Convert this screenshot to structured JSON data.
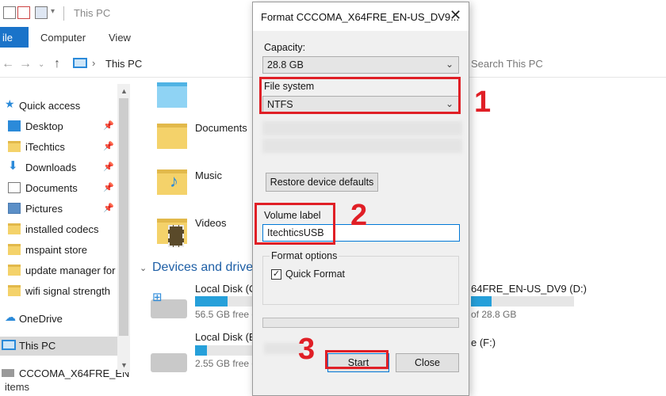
{
  "explorer": {
    "title": "This PC",
    "ribbon_tabs": [
      "ile",
      "Computer",
      "View"
    ],
    "address_text": "This PC",
    "search_placeholder": "Search This PC",
    "nav_items": [
      {
        "label": "Quick access",
        "icon": "star-icon",
        "pinned": false
      },
      {
        "label": "Desktop",
        "icon": "desktop-icon",
        "pinned": true
      },
      {
        "label": "iTechtics",
        "icon": "folder-icon",
        "pinned": true
      },
      {
        "label": "Downloads",
        "icon": "download-icon",
        "pinned": true
      },
      {
        "label": "Documents",
        "icon": "documents-icon",
        "pinned": true
      },
      {
        "label": "Pictures",
        "icon": "pictures-icon",
        "pinned": true
      },
      {
        "label": "installed codecs",
        "icon": "folder-icon",
        "pinned": false
      },
      {
        "label": "mspaint store",
        "icon": "folder-icon",
        "pinned": false
      },
      {
        "label": "update manager for",
        "icon": "folder-icon",
        "pinned": false
      },
      {
        "label": "wifi signal strength",
        "icon": "folder-icon",
        "pinned": false
      },
      {
        "label": "OneDrive",
        "icon": "cloud-icon",
        "pinned": false
      },
      {
        "label": "This PC",
        "icon": "pc-icon",
        "pinned": false
      },
      {
        "label": "CCCOMA_X64FRE_EN",
        "icon": "usb-icon",
        "pinned": false
      }
    ],
    "folders": [
      {
        "label": "Documents"
      },
      {
        "label": "Music"
      },
      {
        "label": "Videos"
      }
    ],
    "devices_heading": "Devices and drive",
    "drives": [
      {
        "label": "Local Disk (C",
        "sub": "56.5 GB free o",
        "used_fraction": 0.55
      },
      {
        "label": "Local Disk (E",
        "sub": "2.55 GB free o",
        "used_fraction": 0.2
      }
    ],
    "usb_drive": {
      "label": "64FRE_EN-US_DV9 (D:)",
      "sub": "of 28.8 GB",
      "used_fraction": 0.2
    },
    "f_drive_label": "e (F:)",
    "status": "items"
  },
  "dialog": {
    "title": "Format CCCOMA_X64FRE_EN-US_DV9...",
    "capacity_label": "Capacity:",
    "capacity_value": "28.8 GB",
    "filesystem_label": "File system",
    "filesystem_value": "NTFS",
    "restore_button": "Restore device defaults",
    "volume_label_label": "Volume label",
    "volume_label_value": "ItechticsUSB",
    "format_options_label": "Format options",
    "quick_format_label": "Quick Format",
    "quick_format_checked": true,
    "start_button": "Start",
    "close_button": "Close"
  },
  "annotations": {
    "step1": "1",
    "step2": "2",
    "step3": "3",
    "color": "#e01f26"
  }
}
